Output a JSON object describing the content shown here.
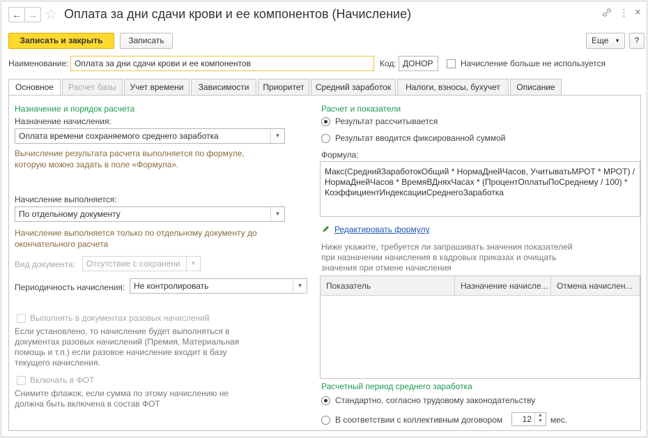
{
  "window": {
    "title": "Оплата за дни сдачи крови и ее компонентов (Начисление)",
    "back_icon": "←",
    "fwd_icon": "→",
    "link_icon": "🔗",
    "menu_icon": "⋮",
    "close_icon": "×"
  },
  "toolbar": {
    "save_close": "Записать и закрыть",
    "save": "Записать",
    "more": "Еще",
    "help": "?"
  },
  "header": {
    "name_label": "Наименование:",
    "name_value": "Оплата за дни сдачи крови и ее компонентов",
    "code_label": "Код:",
    "code_value": "ДОНОР",
    "unused_label": "Начисление больше не используется"
  },
  "tabs": [
    {
      "label": "Основное"
    },
    {
      "label": "Расчет базы"
    },
    {
      "label": "Учет времени"
    },
    {
      "label": "Зависимости"
    },
    {
      "label": "Приоритет"
    },
    {
      "label": "Средний заработок"
    },
    {
      "label": "Налоги, взносы, бухучет"
    },
    {
      "label": "Описание"
    }
  ],
  "left": {
    "section_title": "Назначение и порядок расчета",
    "purpose_label": "Назначение начисления:",
    "purpose_value": "Оплата времени сохраняемого среднего заработка",
    "purpose_note_1": "Вычисление результата расчета выполняется по формуле,",
    "purpose_note_2": "которую можно задать в поле «Формула».",
    "performed_label": "Начисление выполняется:",
    "performed_value": "По отдельному документу",
    "performed_note_1": "Начисление выполняется только по отдельному документу до",
    "performed_note_2": "окончательного расчета",
    "doc_kind_label": "Вид документа:",
    "doc_kind_value": "Отсутствие с сохранени",
    "periodicity_label": "Периодичность начисления:",
    "periodicity_value": "Не контролировать",
    "onetime_label": "Выполнять в документах разовых начислений",
    "onetime_note_1": "Если установлено, то начисление будет выполняться в",
    "onetime_note_2": "документах разовых начислений (Премия, Материальная",
    "onetime_note_3": "помощь и т.п.) если разовое начисление входит в базу",
    "onetime_note_4": "текущего начисления.",
    "fot_label": "Включать в ФОТ",
    "fot_note_1": "Снимите флажок, если сумма по этому начислению не",
    "fot_note_2": "должна быть включена в состав ФОТ"
  },
  "right": {
    "section_title": "Расчет и показатели",
    "radio_calc": "Результат рассчитывается",
    "radio_fixed": "Результат вводится фиксированной суммой",
    "formula_label": "Формула:",
    "formula_1": "Макс(СреднийЗаработокОбщий * НормаДнейЧасов, УчитыватьМРОТ * МРОТ) /",
    "formula_2": "НормаДнейЧасов * ВремяВДняхЧасах * (ПроцентОплатыПоСреднему / 100) *",
    "formula_3": "КоэффициентИндексацииСреднегоЗаработка",
    "edit_formula": "Редактировать формулу",
    "indicators_note_1": "Ниже укажите, требуется ли запрашивать значения показателей",
    "indicators_note_2": "при назначении начисления в кадровых приказах и очищать",
    "indicators_note_3": "значения при отмене начисления",
    "table_headers": [
      "Показатель",
      "Назначение начисле...",
      "Отмена начислен..."
    ],
    "period_title": "Расчетный период среднего заработка",
    "period_standard": "Стандартно, согласно трудовому законодательству",
    "period_collective": "В соответствии с коллективным договором",
    "months_value": "12",
    "months_unit": "мес."
  }
}
